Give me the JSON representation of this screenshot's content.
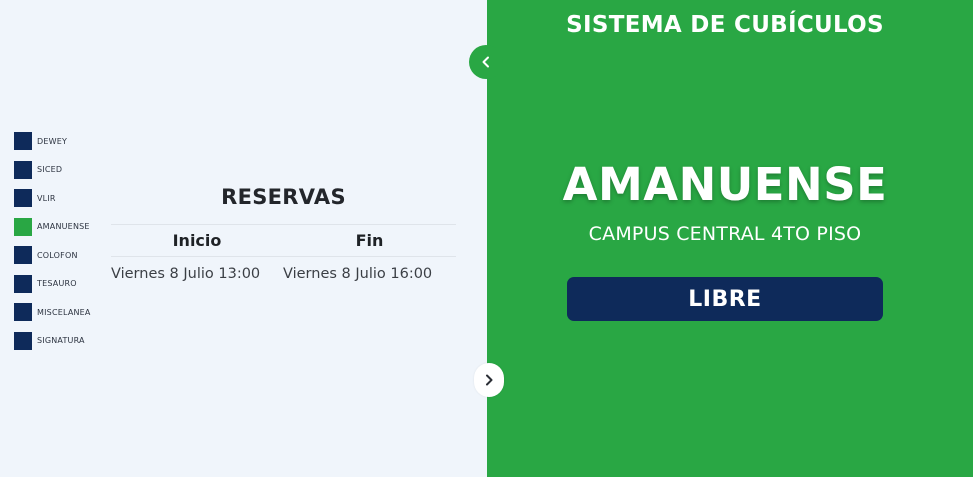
{
  "colors": {
    "left_background": "#f0f5fb",
    "right_background": "#29a744",
    "occupied_swatch": "#0e2a5a",
    "selected_swatch": "#29a744",
    "badge_background": "#0e2a5a"
  },
  "sidebar": {
    "items": [
      {
        "label": "DEWEY",
        "color": "#0e2a5a"
      },
      {
        "label": "SICED",
        "color": "#0e2a5a"
      },
      {
        "label": "VLIR",
        "color": "#0e2a5a"
      },
      {
        "label": "AMANUENSE",
        "color": "#29a744"
      },
      {
        "label": "COLOFON",
        "color": "#0e2a5a"
      },
      {
        "label": "TESAURO",
        "color": "#0e2a5a"
      },
      {
        "label": "MISCELANEA",
        "color": "#0e2a5a"
      },
      {
        "label": "SIGNATURA",
        "color": "#0e2a5a"
      }
    ]
  },
  "reservations": {
    "title": "RESERVAS",
    "columns": {
      "start": "Inicio",
      "end": "Fin"
    },
    "rows": [
      {
        "start": "Viernes 8 Julio 13:00",
        "end": "Viernes 8 Julio 16:00"
      }
    ]
  },
  "controls": {
    "collapse_icon": "chevron-left-icon",
    "expand_icon": "chevron-right-icon"
  },
  "header": {
    "title": "SISTEMA DE CUBÍCULOS"
  },
  "cubicle": {
    "name": "AMANUENSE",
    "location": "CAMPUS CENTRAL 4TO PISO",
    "status": "LIBRE"
  }
}
